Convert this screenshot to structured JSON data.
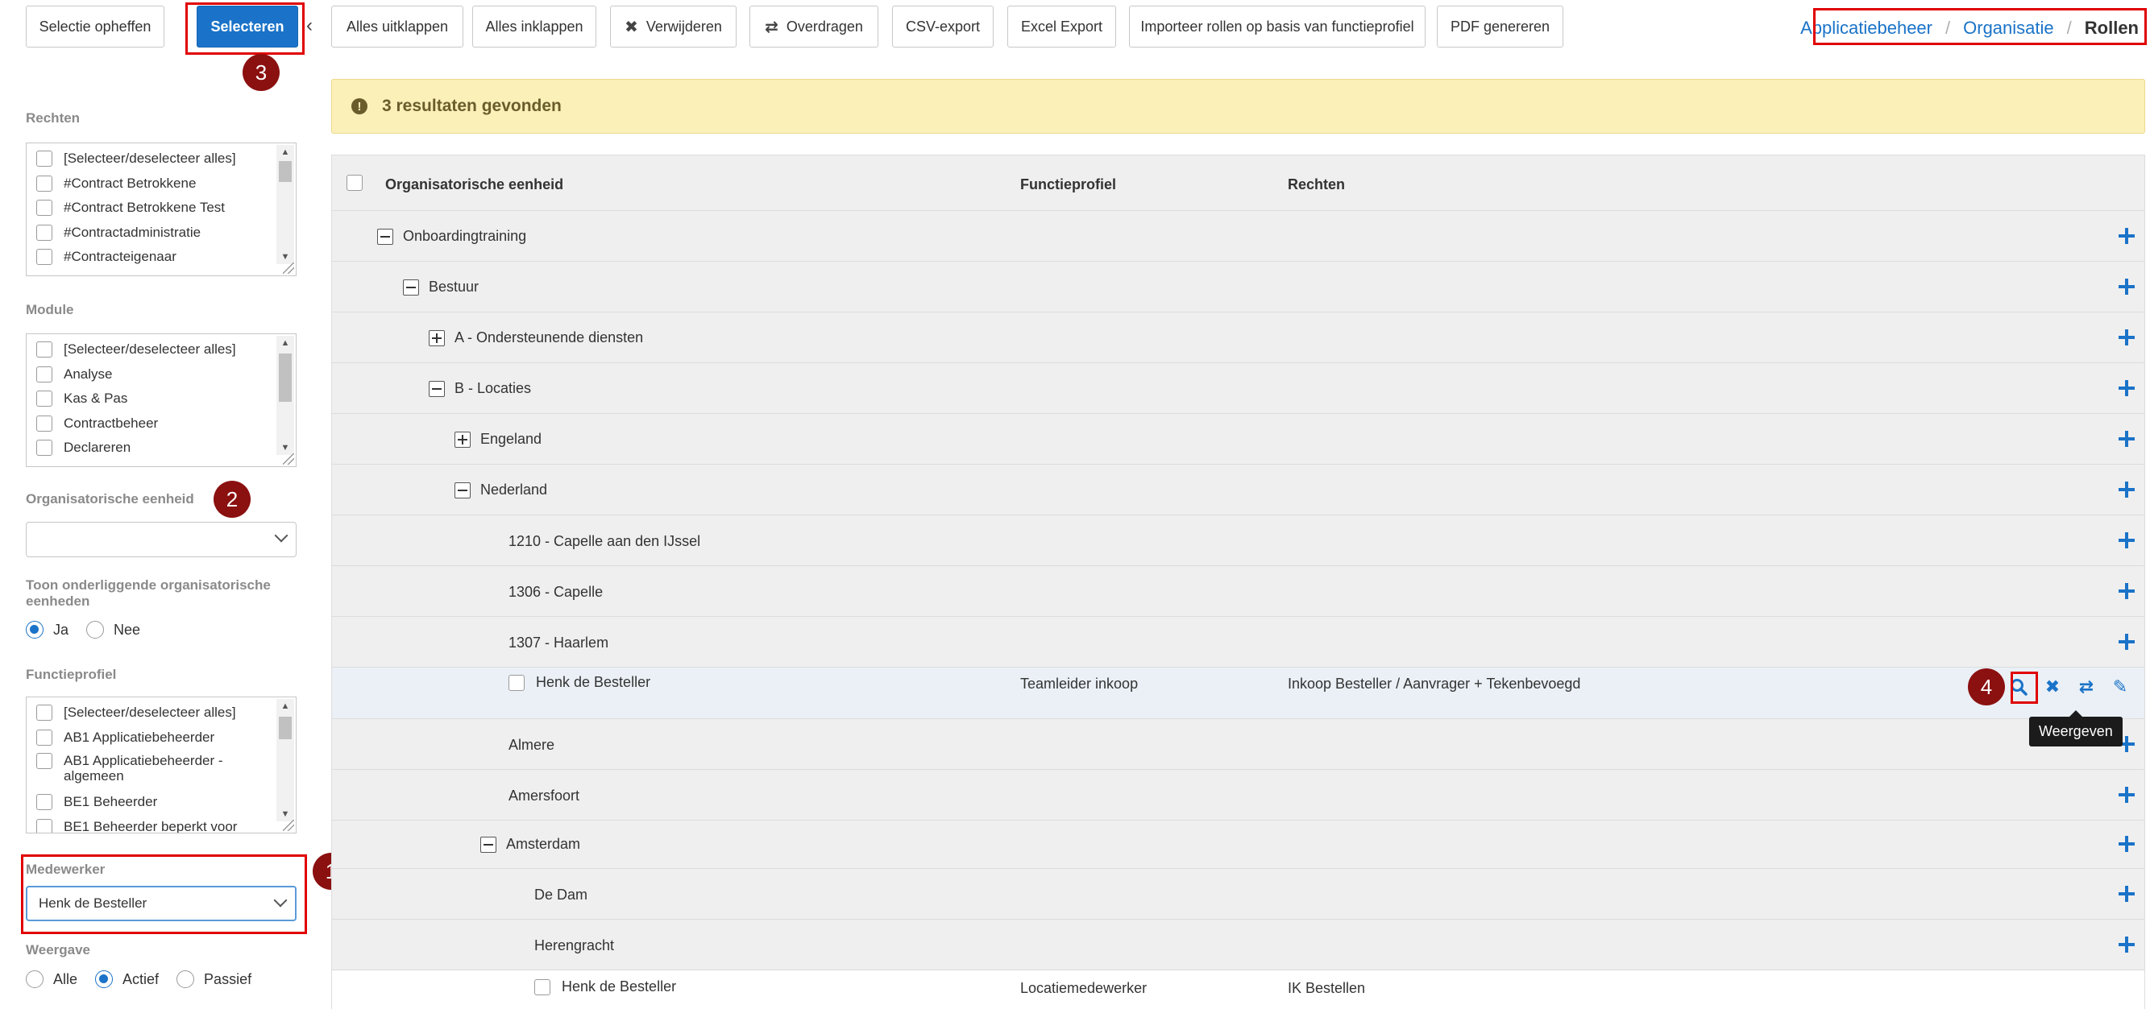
{
  "toolbar": {
    "buttons": [
      {
        "label": "Selectie opheffen"
      },
      {
        "label": "Selecteren"
      },
      {
        "label": "Alles uitklappen"
      },
      {
        "label": "Alles inklappen"
      },
      {
        "label": "Verwijderen",
        "icon": "x-icon"
      },
      {
        "label": "Overdragen",
        "icon": "transfer-icon"
      },
      {
        "label": "CSV-export"
      },
      {
        "label": "Excel Export"
      },
      {
        "label": "Importeer rollen op basis van functieprofiel"
      },
      {
        "label": "PDF genereren"
      }
    ],
    "collapse_icon": "chevron-left-icon"
  },
  "breadcrumb": {
    "items": [
      "Applicatiebeheer",
      "Organisatie"
    ],
    "separator": "/",
    "current": "Rollen"
  },
  "markers": [
    "1",
    "2",
    "3",
    "4"
  ],
  "sidebar": {
    "rechten": {
      "label": "Rechten",
      "items": [
        "[Selecteer/deselecteer alles]",
        "#Contract Betrokkene",
        "#Contract Betrokkene Test",
        "#Contractadministratie",
        "#Contracteigenaar"
      ]
    },
    "module": {
      "label": "Module",
      "items": [
        "[Selecteer/deselecteer alles]",
        "Analyse",
        "Kas & Pas",
        "Contractbeheer",
        "Declareren"
      ]
    },
    "org_eenheid": {
      "label": "Organisatorische eenheid",
      "value": ""
    },
    "toon_onderliggend": {
      "label": "Toon onderliggende organisatorische eenheden",
      "options": [
        "Ja",
        "Nee"
      ],
      "selected": "Ja"
    },
    "functieprofiel": {
      "label": "Functieprofiel",
      "items": [
        "[Selecteer/deselecteer alles]",
        "AB1 Applicatiebeheerder",
        "AB1 Applicatiebeheerder - algemeen",
        "BE1 Beheerder",
        "BE1 Beheerder beperkt voor"
      ]
    },
    "medewerker": {
      "label": "Medewerker",
      "value": "Henk de Besteller"
    },
    "weergave": {
      "label": "Weergave",
      "options": [
        "Alle",
        "Actief",
        "Passief"
      ],
      "selected": "Actief"
    }
  },
  "alert": {
    "text": "3 resultaten gevonden"
  },
  "grid": {
    "columns": [
      "Organisatorische eenheid",
      "Functieprofiel",
      "Rechten"
    ],
    "rows": [
      {
        "label": "Onboardingtraining",
        "toggle": "minus"
      },
      {
        "label": "Bestuur",
        "toggle": "minus"
      },
      {
        "label": "A - Ondersteunende diensten",
        "toggle": "plus"
      },
      {
        "label": "B - Locaties",
        "toggle": "minus"
      },
      {
        "label": "Engeland",
        "toggle": "plus"
      },
      {
        "label": "Nederland",
        "toggle": "minus"
      },
      {
        "label": "1210 - Capelle aan den IJssel",
        "toggle": "none"
      },
      {
        "label": "1306 - Capelle",
        "toggle": "none"
      },
      {
        "label": "1307 - Haarlem",
        "toggle": "none"
      },
      {
        "label": "Henk de Besteller",
        "toggle": "checkbox",
        "functieprofiel": "Teamleider inkoop",
        "rechten": "Inkoop Besteller / Aanvrager + Tekenbevoegd"
      },
      {
        "label": "Almere",
        "toggle": "none"
      },
      {
        "label": "Amersfoort",
        "toggle": "none"
      },
      {
        "label": "Amsterdam",
        "toggle": "minus"
      },
      {
        "label": "De Dam",
        "toggle": "none"
      },
      {
        "label": "Herengracht",
        "toggle": "none"
      },
      {
        "label": "Henk de Besteller",
        "toggle": "checkbox",
        "functieprofiel": "Locatiemedewerker",
        "rechten": "IK Bestellen"
      }
    ],
    "row_actions": [
      "search-icon",
      "x-icon",
      "transfer-icon",
      "pencil-icon"
    ],
    "tooltip": "Weergeven",
    "accent": "#1a73c8"
  }
}
